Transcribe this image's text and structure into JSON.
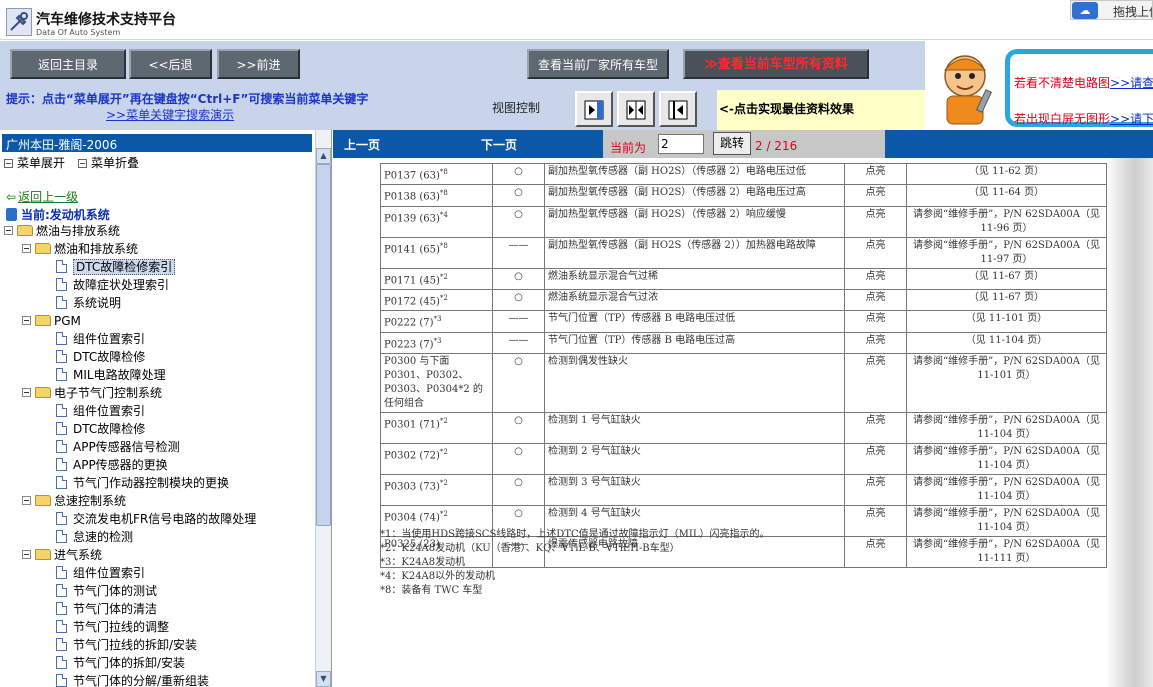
{
  "app": {
    "title": "汽车维修技术支持平台",
    "subtitle": "Data Of Auto System",
    "drag_upload": "拖拽上传"
  },
  "toolbar": {
    "main_menu": "返回主目录",
    "back": "<<后退",
    "forward": ">>前进",
    "maker_models": "查看当前厂家所有车型",
    "model_docs": "查看当前车型所有资料"
  },
  "banner": {
    "line1_text": "若看不清楚电路图",
    "line1_link": ">>请查",
    "line2_text": "若出现白屏无图形",
    "line2_link": ">>请下"
  },
  "hint": {
    "text": "提示：点击“菜单展开”再在键盘按“Ctrl+F”可搜索当前菜单关键字",
    "link": ">>菜单关键字搜索演示",
    "view_control": "视图控制",
    "best_view": "<-点击实现最佳资料效果"
  },
  "sidebar": {
    "title": "广州本田-雅阁-2006",
    "expand": "菜单展开",
    "collapse": "菜单折叠",
    "go_up": "返回上一级",
    "current": "当前:发动机系统",
    "tree": [
      {
        "label": "燃油与排放系统",
        "kind": "folder",
        "level": 0
      },
      {
        "label": "燃油和排放系统",
        "kind": "folder",
        "level": 1
      },
      {
        "label": "DTC故障检修索引",
        "kind": "doc",
        "level": 2,
        "selected": true
      },
      {
        "label": "故障症状处理索引",
        "kind": "doc",
        "level": 2
      },
      {
        "label": "系统说明",
        "kind": "doc",
        "level": 2
      },
      {
        "label": "PGM",
        "kind": "folder",
        "level": 1
      },
      {
        "label": "组件位置索引",
        "kind": "doc",
        "level": 2
      },
      {
        "label": "DTC故障检修",
        "kind": "doc",
        "level": 2
      },
      {
        "label": "MIL电路故障处理",
        "kind": "doc",
        "level": 2
      },
      {
        "label": "电子节气门控制系统",
        "kind": "folder",
        "level": 1
      },
      {
        "label": "组件位置索引",
        "kind": "doc",
        "level": 2
      },
      {
        "label": "DTC故障检修",
        "kind": "doc",
        "level": 2
      },
      {
        "label": "APP传感器信号检测",
        "kind": "doc",
        "level": 2
      },
      {
        "label": "APP传感器的更换",
        "kind": "doc",
        "level": 2
      },
      {
        "label": "节气门作动器控制模块的更换",
        "kind": "doc",
        "level": 2
      },
      {
        "label": "怠速控制系统",
        "kind": "folder",
        "level": 1
      },
      {
        "label": "交流发电机FR信号电路的故障处理",
        "kind": "doc",
        "level": 2
      },
      {
        "label": "怠速的检测",
        "kind": "doc",
        "level": 2
      },
      {
        "label": "进气系统",
        "kind": "folder",
        "level": 1
      },
      {
        "label": "组件位置索引",
        "kind": "doc",
        "level": 2
      },
      {
        "label": "节气门体的测试",
        "kind": "doc",
        "level": 2
      },
      {
        "label": "节气门体的清洁",
        "kind": "doc",
        "level": 2
      },
      {
        "label": "节气门拉线的调整",
        "kind": "doc",
        "level": 2
      },
      {
        "label": "节气门拉线的拆卸/安装",
        "kind": "doc",
        "level": 2
      },
      {
        "label": "节气门体的拆卸/安装",
        "kind": "doc",
        "level": 2
      },
      {
        "label": "节气门体的分解/重新组装",
        "kind": "doc",
        "level": 2
      }
    ]
  },
  "viewer": {
    "prev": "上一页",
    "next": "下一页",
    "current_label": "当前为",
    "page_value": "2",
    "jump": "跳转",
    "page_count": "2 / 216"
  },
  "document": {
    "rows": [
      {
        "code": "P0137 (63)",
        "sup": "*8",
        "mil": "○",
        "desc": "副加热型氧传感器（副 HO2S）（传感器 2）电路电压过低",
        "lamp": "点亮",
        "ref": "（见 11-62 页）"
      },
      {
        "code": "P0138 (63)",
        "sup": "*8",
        "mil": "○",
        "desc": "副加热型氧传感器（副 HO2S）（传感器 2）电路电压过高",
        "lamp": "点亮",
        "ref": "（见 11-64 页）"
      },
      {
        "code": "P0139 (63)",
        "sup": "*4",
        "mil": "○",
        "desc": "副加热型氧传感器（副 HO2S）（传感器 2）响应缓慢",
        "lamp": "点亮",
        "ref": "请参阅“维修手册”，P/N 62SDA00A（见 11-96 页）"
      },
      {
        "code": "P0141 (65)",
        "sup": "*8",
        "mil": "——",
        "desc": "副加热型氧传感器（副 HO2S（传感器 2））加热器电路故障",
        "lamp": "点亮",
        "ref": "请参阅“维修手册”，P/N 62SDA00A（见 11-97 页）"
      },
      {
        "code": "P0171 (45)",
        "sup": "*2",
        "mil": "○",
        "desc": "燃油系统显示混合气过稀",
        "lamp": "点亮",
        "ref": "（见 11-67 页）"
      },
      {
        "code": "P0172 (45)",
        "sup": "*2",
        "mil": "○",
        "desc": "燃油系统显示混合气过浓",
        "lamp": "点亮",
        "ref": "（见 11-67 页）"
      },
      {
        "code": "P0222 (7)",
        "sup": "*3",
        "mil": "——",
        "desc": "节气门位置（TP）传感器 B 电路电压过低",
        "lamp": "点亮",
        "ref": "（见 11-101 页）"
      },
      {
        "code": "P0223 (7)",
        "sup": "*3",
        "mil": "——",
        "desc": "节气门位置（TP）传感器 B 电路电压过高",
        "lamp": "点亮",
        "ref": "（见 11-104 页）"
      },
      {
        "code": "P0300 与下面 P0301、P0302、P0303、P0304*2 的任何组合",
        "sup": "",
        "mil": "○",
        "desc": "检测到偶发性缺火",
        "lamp": "点亮",
        "ref": "请参阅“维修手册”，P/N 62SDA00A（见 11-101 页）",
        "tall": true
      },
      {
        "code": "P0301 (71)",
        "sup": "*2",
        "mil": "○",
        "desc": "检测到 1 号气缸缺火",
        "lamp": "点亮",
        "ref": "请参阅“维修手册”，P/N 62SDA00A（见 11-104 页）"
      },
      {
        "code": "P0302 (72)",
        "sup": "*2",
        "mil": "○",
        "desc": "检测到 2 号气缸缺火",
        "lamp": "点亮",
        "ref": "请参阅“维修手册”，P/N 62SDA00A（见 11-104 页）"
      },
      {
        "code": "P0303 (73)",
        "sup": "*2",
        "mil": "○",
        "desc": "检测到 3 号气缸缺火",
        "lamp": "点亮",
        "ref": "请参阅“维修手册”，P/N 62SDA00A（见 11-104 页）"
      },
      {
        "code": "P0304 (74)",
        "sup": "*2",
        "mil": "○",
        "desc": "检测到 4 号气缸缺火",
        "lamp": "点亮",
        "ref": "请参阅“维修手册”，P/N 62SDA00A（见 11-104 页）"
      },
      {
        "code": "P0325 (23)",
        "sup": "",
        "mil": "——",
        "desc": "爆震传感器电路故障",
        "lamp": "点亮",
        "ref": "请参阅“维修手册”，P/N 62SDA00A（见 11-111 页）"
      }
    ],
    "notes": [
      "*1：当使用HDS跨接SCS线路时，上述DTC值是通过故障指示灯（MIL）闪亮指示的。",
      "*2：K24A8发动机（KU（香港）、KQ、VTiL-B、VTiEH-B车型）",
      "*3：K24A8发动机",
      "*4：K24A8以外的发动机",
      "*8：装备有 TWC 车型"
    ]
  },
  "colors": {
    "accent_blue": "#0b58a8",
    "toolbar_bg": "#c7d4ea",
    "highlight_red": "#e0001b"
  }
}
